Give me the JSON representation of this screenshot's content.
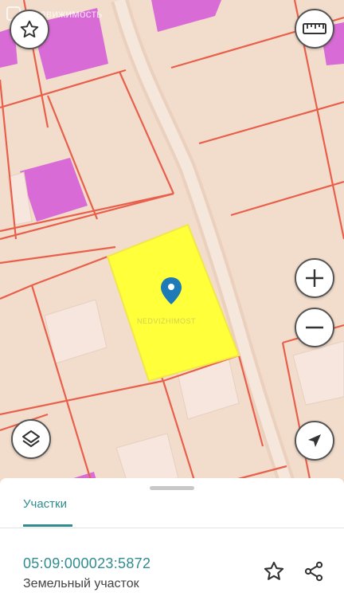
{
  "map": {
    "watermark_text": "Недвижимость",
    "center_watermark_text": "NEDVIZHIMOST",
    "colors": {
      "background": "#f2dccb",
      "boundary": "#e8604c",
      "building": "#d96bd6",
      "selected_parcel": "#ffff3a",
      "road": "#ead0bd",
      "pin": "#1f7ab8"
    },
    "controls": {
      "favorite_icon": "star-outline-icon",
      "ruler_icon": "ruler-icon",
      "zoom_in_icon": "plus-icon",
      "zoom_out_icon": "minus-icon",
      "layers_icon": "layers-icon",
      "locate_icon": "navigation-arrow-icon"
    }
  },
  "sheet": {
    "tab_label": "Участки",
    "cadastral_number": "05:09:000023:5872",
    "object_type": "Земельный участок",
    "actions": {
      "favorite_icon": "star-outline-icon",
      "share_icon": "share-icon"
    }
  }
}
